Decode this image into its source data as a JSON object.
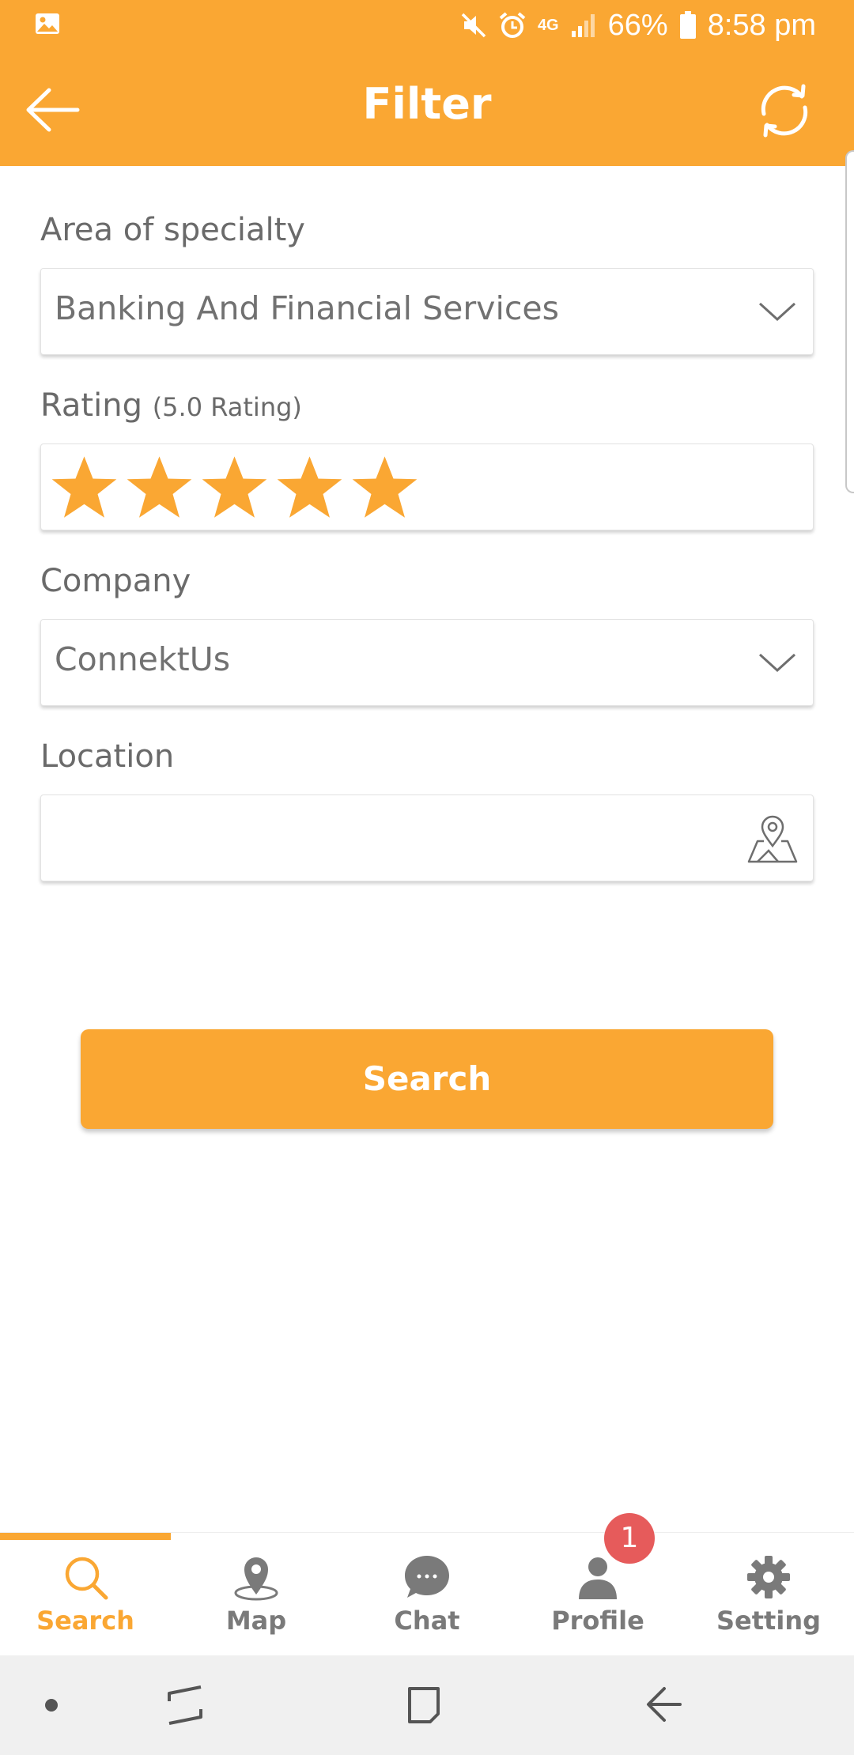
{
  "status_bar": {
    "network": "4G",
    "battery": "66%",
    "time": "8:58 pm"
  },
  "header": {
    "title": "Filter",
    "back_icon": "arrow-left-icon",
    "refresh_icon": "refresh-icon"
  },
  "form": {
    "specialty": {
      "label": "Area of specialty",
      "value": "Banking And Financial Services"
    },
    "rating": {
      "label": "Rating",
      "sublabel": "(5.0 Rating)",
      "value": 5,
      "max": 5,
      "star_color": "#faa733"
    },
    "company": {
      "label": "Company",
      "value": "ConnektUs"
    },
    "location": {
      "label": "Location",
      "value": ""
    }
  },
  "search_button": "Search",
  "bottom_nav": {
    "items": [
      {
        "label": "Search",
        "icon": "search-icon",
        "active": true
      },
      {
        "label": "Map",
        "icon": "map-pin-icon",
        "active": false
      },
      {
        "label": "Chat",
        "icon": "chat-bubble-icon",
        "active": false
      },
      {
        "label": "Profile",
        "icon": "person-icon",
        "active": false
      },
      {
        "label": "Setting",
        "icon": "gear-icon",
        "active": false
      }
    ],
    "profile_badge": "1"
  },
  "colors": {
    "accent": "#faa733",
    "badge": "#e65b5b",
    "text": "#6e6e6e"
  }
}
